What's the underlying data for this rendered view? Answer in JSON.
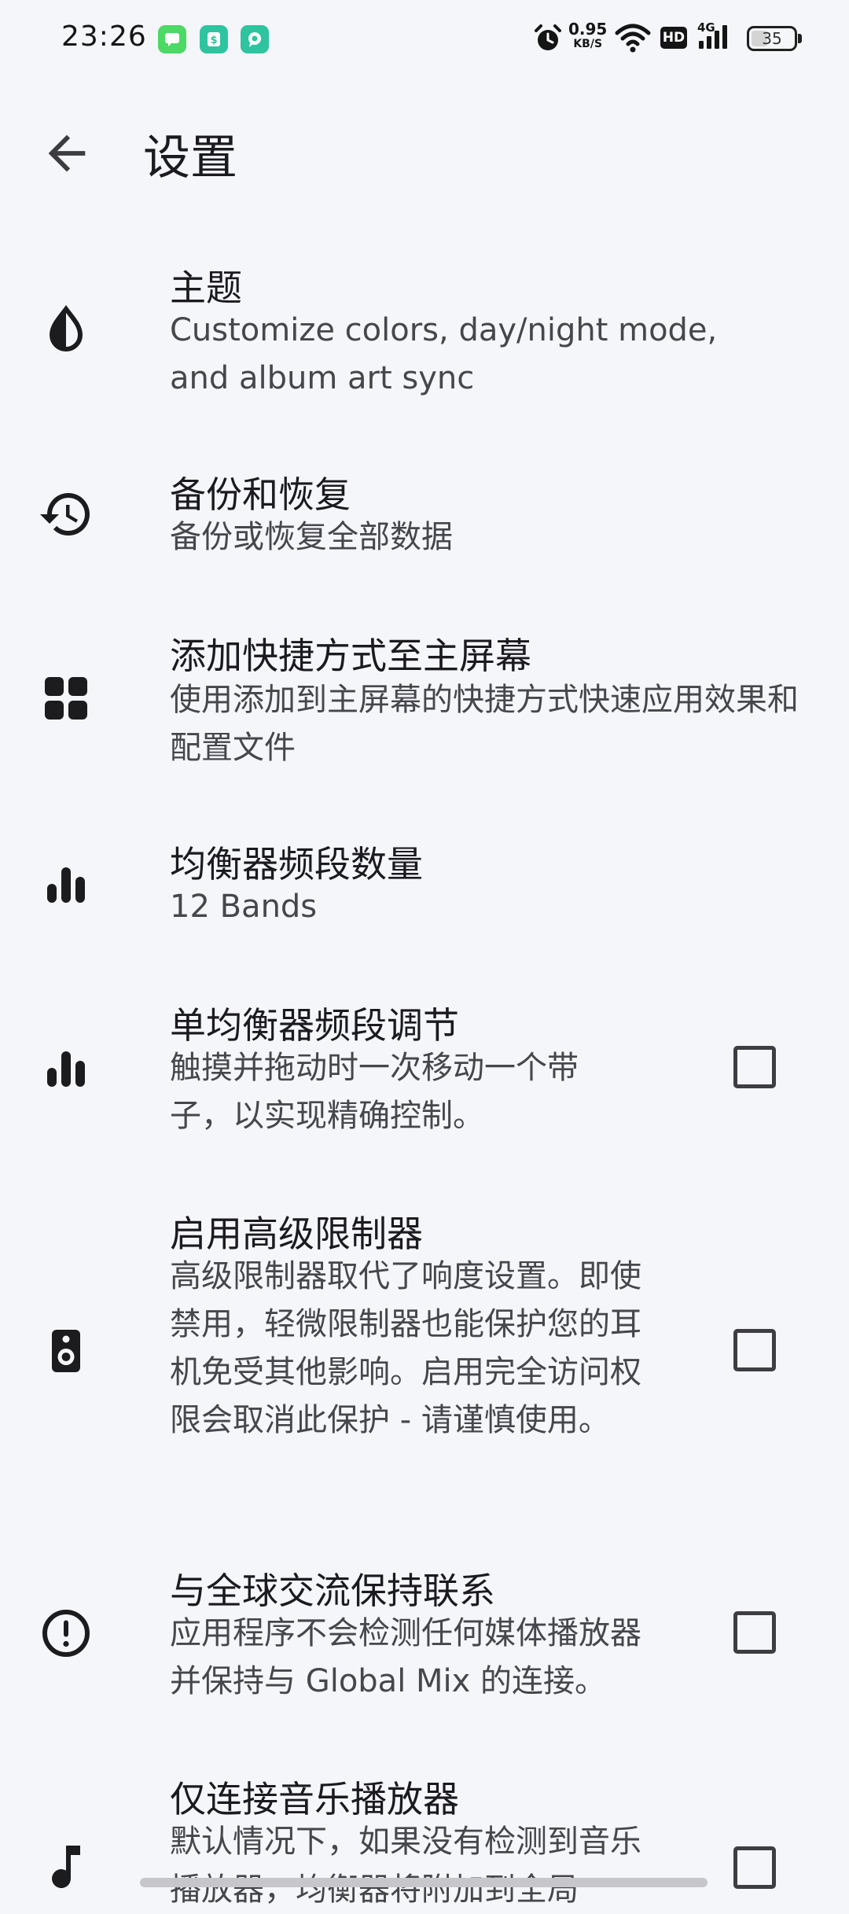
{
  "status_bar": {
    "time": "23:26",
    "net_speed_value": "0.95",
    "net_speed_unit": "KB/S",
    "battery": "35",
    "battery_level_percent": 35,
    "network_type": "4G",
    "hd_label": "HD",
    "notifications": [
      {
        "icon": "messages-app-icon",
        "color": "#4cd964"
      },
      {
        "icon": "money-app-icon",
        "color": "#2ec4a0"
      },
      {
        "icon": "chat-app-icon",
        "color": "#2ec4a0"
      }
    ]
  },
  "app_bar": {
    "title": "设置",
    "back_icon": "arrow-back-icon"
  },
  "settings": [
    {
      "id": "theme",
      "icon": "contrast-drop-icon",
      "label": "主题",
      "summary": "Customize colors, day/night mode, and album art sync",
      "has_checkbox": false
    },
    {
      "id": "backup",
      "icon": "restore-history-icon",
      "label": "备份和恢复",
      "summary": "备份或恢复全部数据",
      "has_checkbox": false
    },
    {
      "id": "shortcuts",
      "icon": "grid-widgets-icon",
      "label": "添加快捷方式至主屏幕",
      "summary": "使用添加到主屏幕的快捷方式快速应用效果和配置文件",
      "has_checkbox": false
    },
    {
      "id": "eq-bands",
      "icon": "equalizer-bars-icon",
      "label": "均衡器频段数量",
      "summary": "12 Bands",
      "has_checkbox": false
    },
    {
      "id": "single-band",
      "icon": "equalizer-bars-icon",
      "label": "单均衡器频段调节",
      "summary": "触摸并拖动时一次移动一个带子，以实现精确控制。",
      "has_checkbox": true,
      "checked": false
    },
    {
      "id": "advanced-limiter",
      "icon": "speaker-icon",
      "label": "启用高级限制器",
      "summary": "高级限制器取代了响度设置。即使禁用，轻微限制器也能保护您的耳机免受其他影响。启用完全访问权限会取消此保护 - 请谨慎使用。",
      "has_checkbox": true,
      "checked": false
    },
    {
      "id": "global-connection",
      "icon": "alert-circle-icon",
      "label": "与全球交流保持联系",
      "summary": "应用程序不会检测任何媒体播放器并保持与 Global Mix 的连接。",
      "has_checkbox": true,
      "checked": false
    },
    {
      "id": "music-only",
      "icon": "music-note-icon",
      "label": "仅连接音乐播放器",
      "summary": "默认情况下，如果没有检测到音乐播放器，均衡器将附加到全局",
      "has_checkbox": true,
      "checked": false
    }
  ]
}
